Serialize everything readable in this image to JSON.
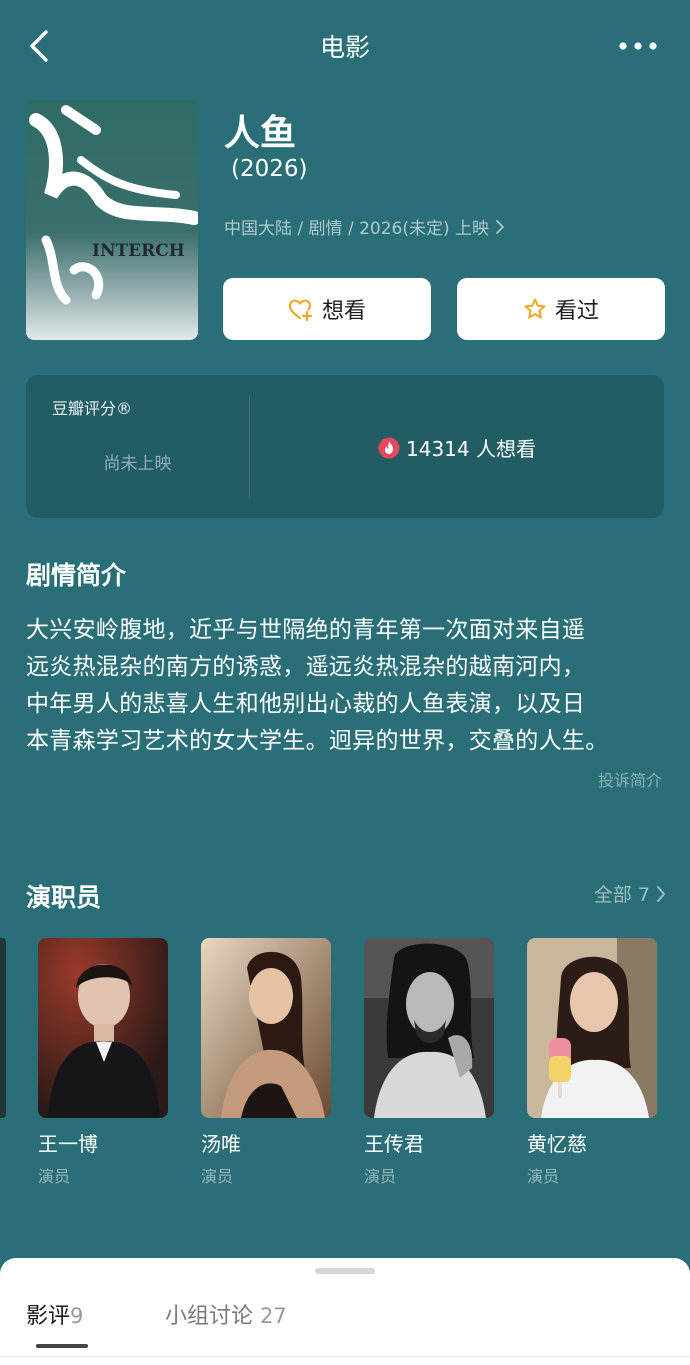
{
  "header": {
    "title": "电影"
  },
  "movie": {
    "title": "人鱼",
    "year": "(2026)",
    "meta": "中国大陆 / 剧情 / 2026(未定) 上映",
    "poster_text": "INTERCH",
    "poster_glyph": "人鱼"
  },
  "actions": {
    "wish_label": "想看",
    "seen_label": "看过"
  },
  "rating": {
    "label": "豆瓣评分®",
    "status": "尚未上映",
    "want_count_text": "14314 人想看"
  },
  "synopsis": {
    "title": "剧情简介",
    "lines": [
      "大兴安岭腹地，近乎与世隔绝的青年第一次面对来自遥",
      "远炎热混杂的南方的诱惑，遥远炎热混杂的越南河内，",
      "中年男人的悲喜人生和他别出心裁的人鱼表演，以及日",
      "本青森学习艺术的女大学生。迥异的世界，交叠的人生。"
    ],
    "report_label": "投诉简介"
  },
  "cast": {
    "title": "演职员",
    "all_label": "全部 7",
    "members": [
      {
        "name": "王一博",
        "role": "演员"
      },
      {
        "name": "汤唯",
        "role": "演员"
      },
      {
        "name": "王传君",
        "role": "演员"
      },
      {
        "name": "黄忆慈",
        "role": "演员"
      }
    ]
  },
  "tabs": {
    "reviews_label": "影评",
    "reviews_count": "9",
    "groups_label": "小组讨论",
    "groups_count": "27"
  },
  "colors": {
    "background": "#2a6f78",
    "card": "#225d66",
    "heart_accent": "#f5a623",
    "hot_icon": "#e9475b"
  }
}
